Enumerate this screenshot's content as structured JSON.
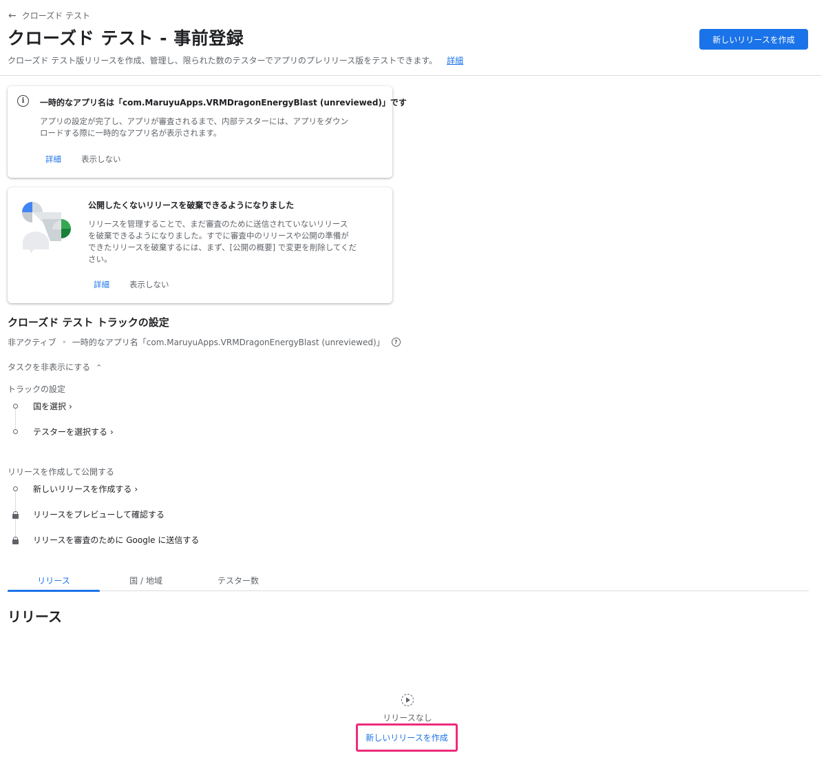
{
  "breadcrumb": {
    "back_label": "クローズド テスト"
  },
  "header": {
    "title": "クローズド テスト - 事前登録",
    "description": "クローズド テスト版リリースを作成、管理し、限られた数のテスターでアプリのプレリリース版をテストできます。",
    "learn_more": "詳細",
    "create_release_button": "新しいリリースを作成"
  },
  "notice_card": {
    "title": "一時的なアプリ名は「com.MaruyuApps.VRMDragonEnergyBlast (unreviewed)」です",
    "body_line1": "アプリの設定が完了し、アプリが審査されるまで、内部テスターには、アプリをダウン",
    "body_line2": "ロードする際に一時的なアプリ名が表示されます。",
    "learn_more": "詳細",
    "dismiss": "表示しない"
  },
  "discard_card": {
    "title": "公開したくないリリースを破棄できるようになりました",
    "body_line1": "リリースを管理することで、まだ審査のために送信されていないリリース",
    "body_line2": "を破棄できるようになりました。すでに審査中のリリースや公開の準備が",
    "body_line3": "できたリリースを破棄するには、まず、[公開の概要] で変更を削除してくだ",
    "body_line4": "さい。",
    "learn_more": "詳細",
    "dismiss": "表示しない"
  },
  "track_settings": {
    "title": "クローズド テスト トラックの設定",
    "status": "非アクティブ",
    "separator": "•",
    "temp_name": "一時的なアプリ名「com.MaruyuApps.VRMDragonEnergyBlast (unreviewed)」",
    "toggle_tasks": "タスクを非表示にする",
    "group1_label": "トラックの設定",
    "task_countries": "国を選択",
    "task_testers": "テスターを選択する",
    "group2_label": "リリースを作成して公開する",
    "task_new_release": "新しいリリースを作成する",
    "task_preview": "リリースをプレビューして確認する",
    "task_submit": "リリースを審査のために Google に送信する"
  },
  "tabs": {
    "releases": "リリース",
    "countries": "国 / 地域",
    "testers": "テスター数"
  },
  "releases_section": {
    "heading": "リリース",
    "empty_text": "リリースなし",
    "create_button": "新しいリリースを作成"
  },
  "colors": {
    "accent": "#1a73e8",
    "highlight_border": "#ee2a7b"
  }
}
